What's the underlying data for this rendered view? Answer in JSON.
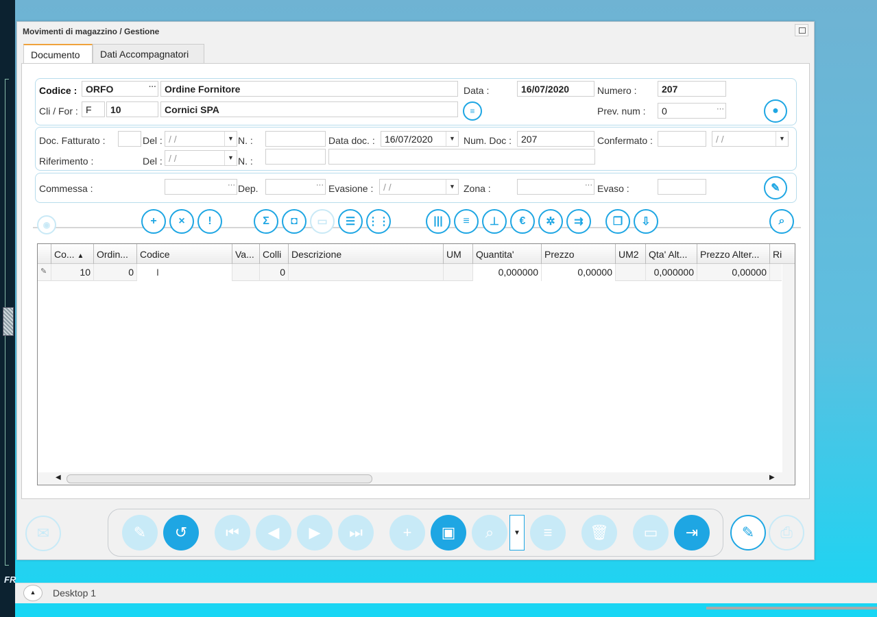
{
  "window": {
    "title": "Movimenti di magazzino / Gestione"
  },
  "tabs": [
    {
      "label": "Documento"
    },
    {
      "label": "Dati Accompagnatori"
    }
  ],
  "header": {
    "codice_label": "Codice :",
    "codice_value": "ORFO",
    "codice_desc": "Ordine Fornitore",
    "clifor_label": "Cli / For :",
    "clifor_type": "F",
    "clifor_code": "10",
    "clifor_name": "Cornici SPA",
    "data_label": "Data :",
    "data_value": "16/07/2020",
    "numero_label": "Numero :",
    "numero_value": "207",
    "prevnum_label": "Prev. num :",
    "prevnum_value": "0"
  },
  "doc": {
    "fatturato_label": "Doc. Fatturato :",
    "del_label": "Del :",
    "n_label": "N. :",
    "empty_date": " /  / ",
    "datadoc_label": "Data doc. :",
    "datadoc_value": "16/07/2020",
    "numdoc_label": "Num. Doc :",
    "numdoc_value": "207",
    "confermato_label": "Confermato :",
    "riferimento_label": "Riferimento :"
  },
  "commessa": {
    "commessa_label": "Commessa :",
    "dep_label": "Dep.",
    "evasione_label": "Evasione :",
    "zona_label": "Zona :",
    "evaso_label": "Evaso :",
    "empty_date": " /  / "
  },
  "grid": {
    "columns": [
      "Co...",
      "Ordin...",
      "Codice",
      "Va...",
      "Colli",
      "Descrizione",
      "UM",
      "Quantita'",
      "Prezzo",
      "UM2",
      "Qta' Alt...",
      "Prezzo Alter...",
      "Ri"
    ],
    "row": {
      "co": "10",
      "ordine": "0",
      "colli": "0",
      "quantita": "0,000000",
      "prezzo": "0,00000",
      "qta_alt": "0,000000",
      "prezzo_alt": "0,00000"
    }
  },
  "taskbar": {
    "label": "Desktop 1"
  },
  "side": {
    "fr": "FR"
  },
  "colors": {
    "accent": "#1ea6e3",
    "tab_active": "#f0a23b"
  }
}
